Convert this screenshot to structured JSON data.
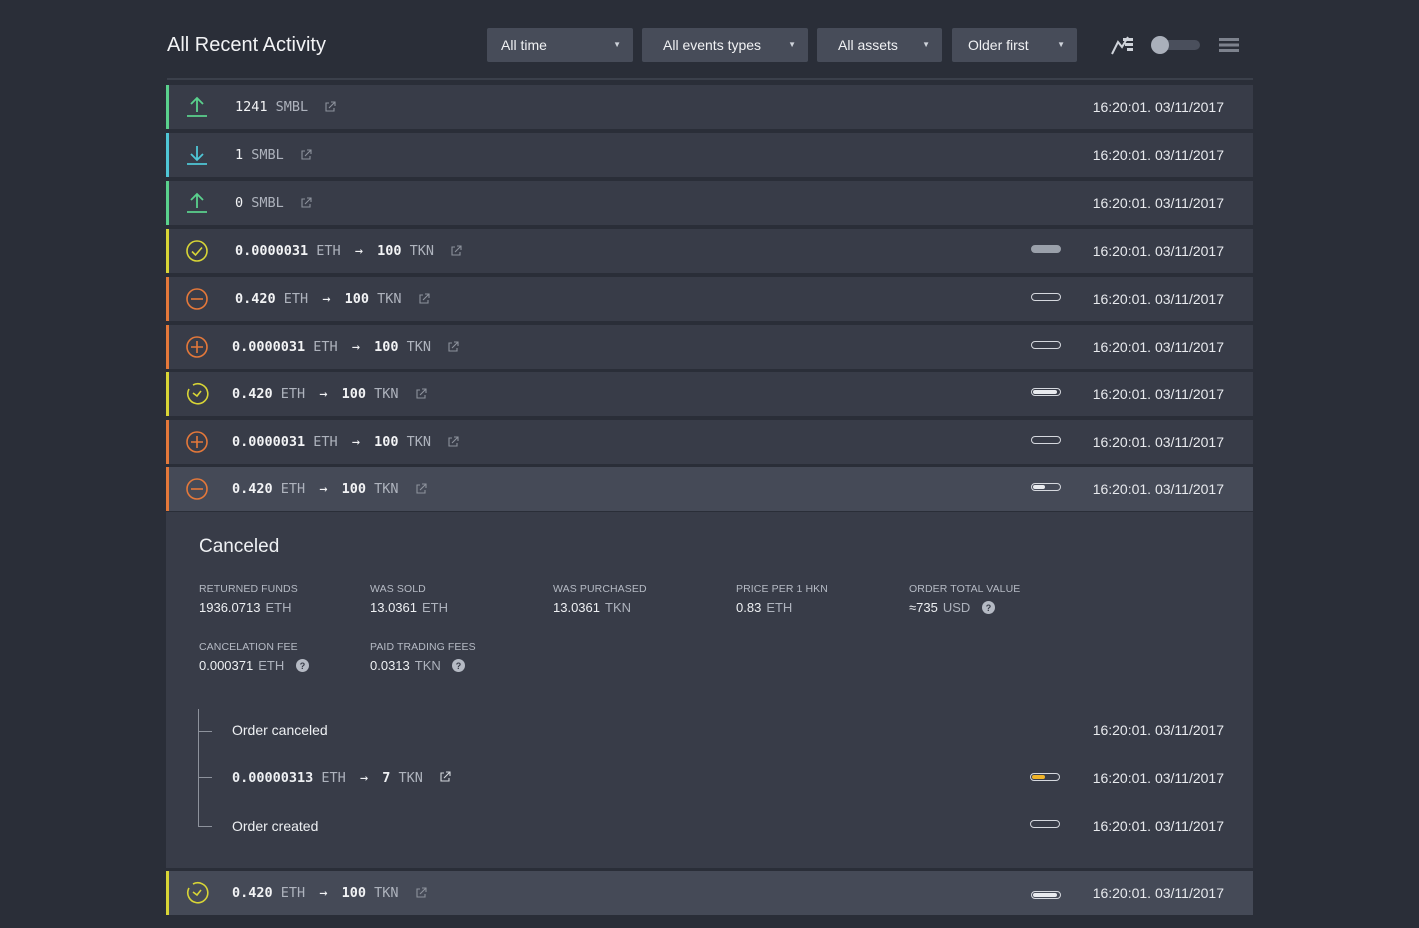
{
  "header": {
    "title": "All Recent Activity",
    "filters": {
      "time": "All time",
      "events": "All events types",
      "assets": "All assets",
      "order": "Older first"
    },
    "icons": [
      "chart-icon",
      "toggle-switch",
      "list-view-icon"
    ]
  },
  "rows": [
    {
      "kind": "upload",
      "amount": "1241",
      "unit": "SMBL",
      "timestamp": "16:20:01. 03/11/2017"
    },
    {
      "kind": "download",
      "amount": "1",
      "unit": "SMBL",
      "timestamp": "16:20:01. 03/11/2017"
    },
    {
      "kind": "upload",
      "amount": "0",
      "unit": "SMBL",
      "timestamp": "16:20:01. 03/11/2017"
    },
    {
      "kind": "completed",
      "from_amount": "0.0000031",
      "from_unit": "ETH",
      "arrow": "→",
      "to_amount": "100",
      "to_unit": "TKN",
      "timestamp": "16:20:01. 03/11/2017"
    },
    {
      "kind": "canceled",
      "from_amount": "0.420",
      "from_unit": "ETH",
      "arrow": "→",
      "to_amount": "100",
      "to_unit": "TKN",
      "timestamp": "16:20:01. 03/11/2017"
    },
    {
      "kind": "created",
      "from_amount": "0.0000031",
      "from_unit": "ETH",
      "arrow": "→",
      "to_amount": "100",
      "to_unit": "TKN",
      "timestamp": "16:20:01. 03/11/2017"
    },
    {
      "kind": "pending",
      "from_amount": "0.420",
      "from_unit": "ETH",
      "arrow": "→",
      "to_amount": "100",
      "to_unit": "TKN",
      "timestamp": "16:20:01. 03/11/2017"
    },
    {
      "kind": "created",
      "from_amount": "0.0000031",
      "from_unit": "ETH",
      "arrow": "→",
      "to_amount": "100",
      "to_unit": "TKN",
      "timestamp": "16:20:01. 03/11/2017"
    },
    {
      "kind": "canceled",
      "from_amount": "0.420",
      "from_unit": "ETH",
      "arrow": "→",
      "to_amount": "100",
      "to_unit": "TKN",
      "timestamp": "16:20:01. 03/11/2017"
    },
    {
      "kind": "pending",
      "from_amount": "0.420",
      "from_unit": "ETH",
      "arrow": "→",
      "to_amount": "100",
      "to_unit": "TKN",
      "timestamp": "16:20:01. 03/11/2017"
    }
  ],
  "detail": {
    "status": "Canceled",
    "fields": {
      "returned_funds": {
        "label": "RETURNED FUNDS",
        "value": "1936.0713",
        "unit": "ETH"
      },
      "was_sold": {
        "label": "WAS SOLD",
        "value": "13.0361",
        "unit": "ETH"
      },
      "was_purchased": {
        "label": "WAS PURCHASED",
        "value": "13.0361",
        "unit": "TKN"
      },
      "price": {
        "label": "PRICE PER 1 HKN",
        "value": "0.83",
        "unit": "ETH"
      },
      "total": {
        "label": "ORDER TOTAL VALUE",
        "value": "≈735",
        "unit": "USD"
      },
      "cancel_fee": {
        "label": "CANCELATION FEE",
        "value": "0.000371",
        "unit": "ETH"
      },
      "trading_fees": {
        "label": "PAID TRADING FEES",
        "value": "0.0313",
        "unit": "TKN"
      }
    },
    "history": {
      "canceled": {
        "label": "Order canceled",
        "timestamp": "16:20:01. 03/11/2017"
      },
      "trade": {
        "from_amount": "0.00000313",
        "from_unit": "ETH",
        "arrow": "→",
        "to_amount": "7",
        "to_unit": "TKN",
        "timestamp": "16:20:01. 03/11/2017"
      },
      "created": {
        "label": "Order created",
        "timestamp": "16:20:01. 03/11/2017"
      }
    }
  },
  "colors": {
    "background": "#2a2e38",
    "row": "#383c48",
    "row_active": "#454a57",
    "green": "#5ad18d",
    "cyan": "#4fc6d6",
    "yellow": "#d8d536",
    "orange": "#e4783a",
    "progress_fill": "#f0b429"
  }
}
